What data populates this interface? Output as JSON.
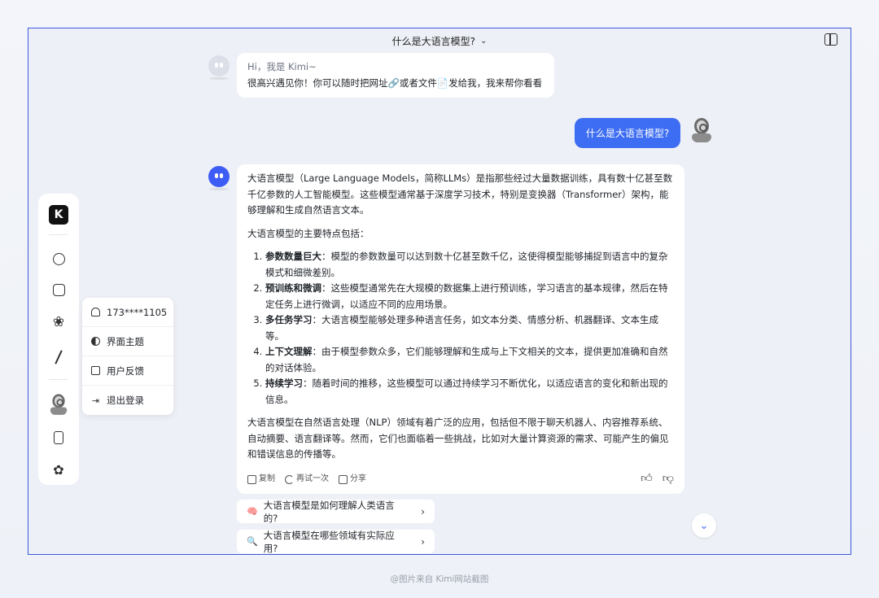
{
  "header": {
    "title": "什么是大语言模型?"
  },
  "greeting": {
    "hi": "Hi，我是 Kimi~",
    "line_before_link": "很高兴遇见你！你可以随时把网址",
    "link_icon": "🔗",
    "line_middle": "或者文件",
    "file_icon": "📄",
    "line_after": "发给我，我来帮你看看"
  },
  "user_message": {
    "text": "什么是大语言模型?"
  },
  "answer": {
    "intro": "大语言模型（Large Language Models，简称LLMs）是指那些经过大量数据训练，具有数十亿甚至数千亿参数的人工智能模型。这些模型通常基于深度学习技术，特别是变换器（Transformer）架构，能够理解和生成自然语言文本。",
    "features_heading": "大语言模型的主要特点包括：",
    "features": [
      {
        "title": "参数数量巨大",
        "text": "：模型的参数数量可以达到数十亿甚至数千亿，这使得模型能够捕捉到语言中的复杂模式和细微差别。"
      },
      {
        "title": "预训练和微调",
        "text": "：这些模型通常先在大规模的数据集上进行预训练，学习语言的基本规律，然后在特定任务上进行微调，以适应不同的应用场景。"
      },
      {
        "title": "多任务学习",
        "text": "：大语言模型能够处理多种语言任务，如文本分类、情感分析、机器翻译、文本生成等。"
      },
      {
        "title": "上下文理解",
        "text": "：由于模型参数众多，它们能够理解和生成与上下文相关的文本，提供更加准确和自然的对话体验。"
      },
      {
        "title": "持续学习",
        "text": "：随着时间的推移，这些模型可以通过持续学习不断优化，以适应语言的变化和新出现的信息。"
      }
    ],
    "conclusion": "大语言模型在自然语言处理（NLP）领域有着广泛的应用，包括但不限于聊天机器人、内容推荐系统、自动摘要、语言翻译等。然而，它们也面临着一些挑战，比如对大量计算资源的需求、可能产生的偏见和错误信息的传播等。",
    "actions": {
      "copy": "复制",
      "retry": "再试一次",
      "share": "分享"
    }
  },
  "suggestions": [
    {
      "icon": "🧠",
      "text": "大语言模型是如何理解人类语言的?"
    },
    {
      "icon": "🔍",
      "text": "大语言模型在哪些领域有实际应用?"
    }
  ],
  "sidebar": {
    "logo": "K"
  },
  "user_menu": {
    "items": [
      {
        "label": "173****1105"
      },
      {
        "label": "界面主题"
      },
      {
        "label": "用户反馈"
      },
      {
        "label": "退出登录"
      }
    ]
  },
  "caption": "@图片来自 Kimi网站截图",
  "colors": {
    "accent": "#3d6df2",
    "frame_border": "#3b5bdb",
    "bot_avatar": "#3d5cf5"
  }
}
